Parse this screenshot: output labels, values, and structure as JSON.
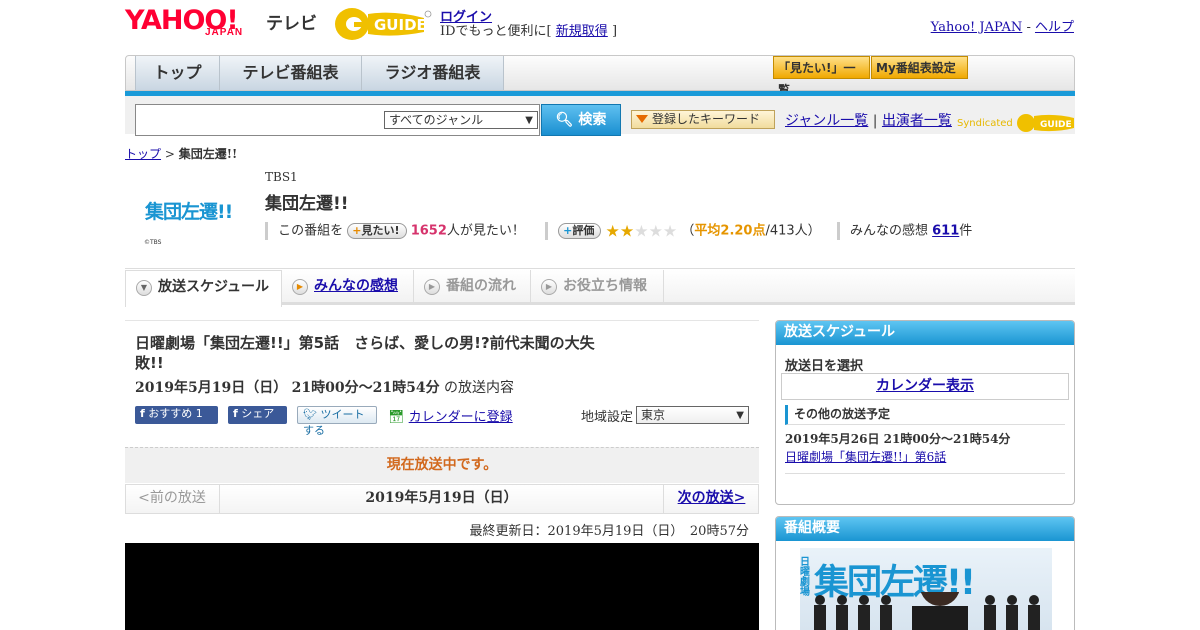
{
  "header": {
    "logo_yahoo": "YAHOO!",
    "logo_japan": "JAPAN",
    "logo_tv": "テレビ",
    "logo_gguide": "G-GUIDE",
    "login": "ログイン",
    "id_prefix": "IDでもっと便利に[",
    "signup": "新規取得",
    "id_suffix": "]",
    "yahoo_japan": "Yahoo! JAPAN",
    "sep": "-",
    "help": "ヘルプ"
  },
  "nav": {
    "tabs": [
      "トップ",
      "テレビ番組表",
      "ラジオ番組表"
    ],
    "want_list": "「見たい!」一覧",
    "my_settings": "My番組表設定"
  },
  "search": {
    "genre": "すべてのジャンル",
    "button": "検索",
    "keyword_btn": "登録したキーワード",
    "genre_list": "ジャンル一覧",
    "divider": "|",
    "performer_list": "出演者一覧",
    "syndicated": "Syndicated"
  },
  "breadcrumb": {
    "home": "トップ",
    "sep": ">",
    "current": "集団左遷!!"
  },
  "program": {
    "thumb_text": "集団左遷!!",
    "thumb_copy": "©TBS",
    "channel": "TBS1",
    "title": "集団左遷!!",
    "want_prefix": "この番組を",
    "want_btn": "見たい!",
    "want_count": "1652",
    "want_suffix": "人が見たい！",
    "rating_btn": "評価",
    "rating": 2.2,
    "avg_label": "（",
    "avg_value": "平均2.20点",
    "avg_count": "/413人）",
    "comments_label": "みんなの感想",
    "comments_count": "611",
    "comments_unit": "件"
  },
  "subtabs": [
    "放送スケジュール",
    "みんなの感想",
    "番組の流れ",
    "お役立ち情報"
  ],
  "episode": {
    "title": "日曜劇場「集団左遷!!」第5話　さらば、愛しの男!?前代未聞の大失敗!!",
    "date": "2019年5月19日（日）",
    "time": "21時00分～21時54分",
    "suffix": "の放送内容",
    "fb_recommend": "おすすめ 1",
    "fb_share": "シェア",
    "tweet": "ツイートする",
    "calendar": "カレンダーに登録",
    "region_label": "地域設定",
    "region_value": "東京",
    "onair": "現在放送中です。",
    "prev": "<前の放送",
    "current_date": "2019年5月19日（日）",
    "next": "次の放送>",
    "updated": "最終更新日：2019年5月19日（日）　20時57分"
  },
  "sidebar": {
    "schedule_head": "放送スケジュール",
    "select_date": "放送日を選択",
    "calendar_btn": "カレンダー表示",
    "other_head": "その他の放送予定",
    "other_date": "2019年5月26日  21時00分～21時54分",
    "other_link": "日曜劇場「集団左遷!!」第6話",
    "overview_head": "番組概要",
    "poster_small": "日曜劇場",
    "poster_title": "集団左遷!!"
  },
  "colors": {
    "accent": "#1a95d2",
    "brand_red": "#ff0033",
    "gguide_yellow": "#f0c000"
  }
}
